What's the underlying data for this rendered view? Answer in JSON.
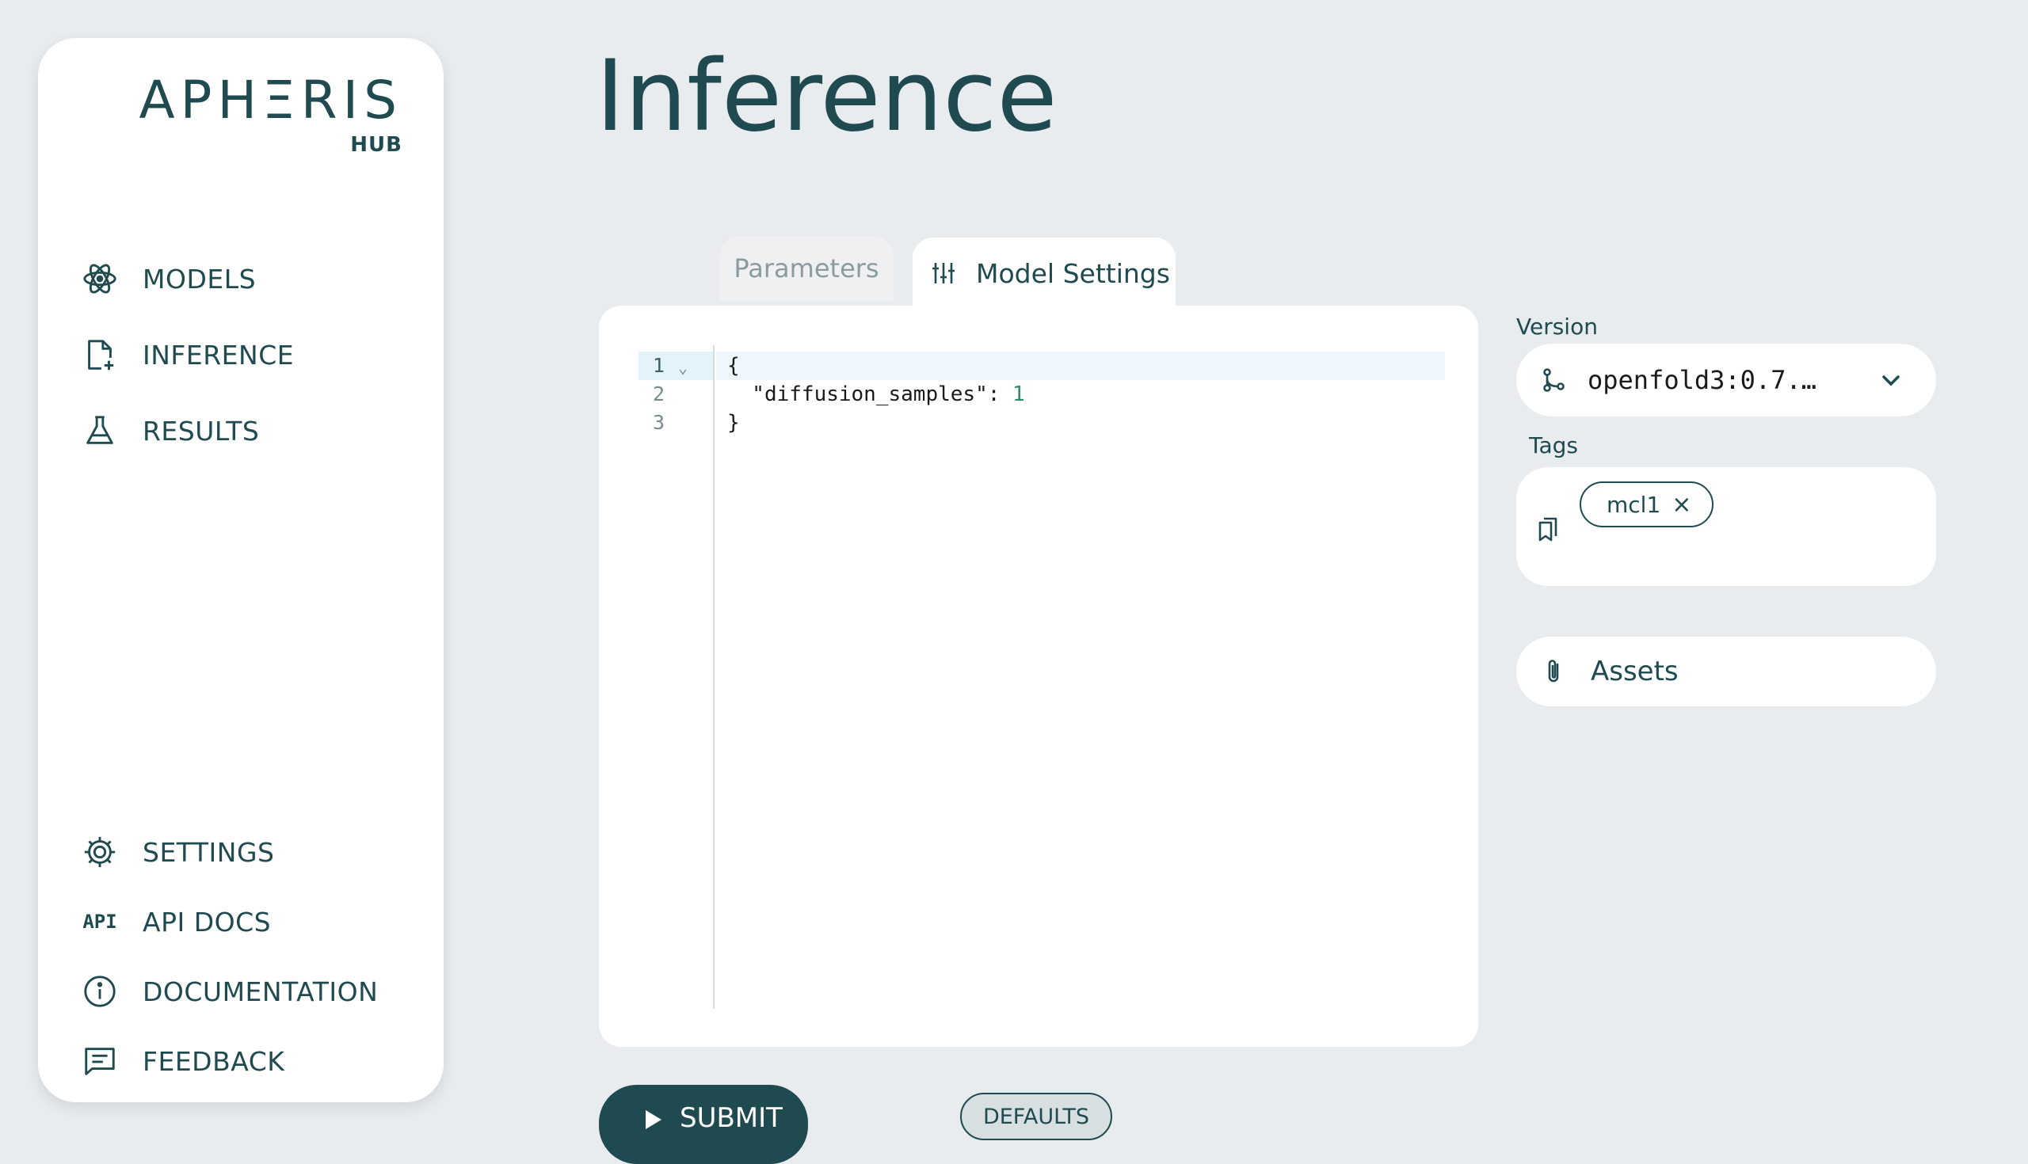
{
  "logo": {
    "word": "APHΞRIS",
    "sub": "HUB"
  },
  "sidebar": {
    "top_items": [
      {
        "label": "MODELS",
        "icon": "atom-icon"
      },
      {
        "label": "INFERENCE",
        "icon": "file-plus-icon"
      },
      {
        "label": "RESULTS",
        "icon": "flask-icon"
      }
    ],
    "bottom_items": [
      {
        "label": "SETTINGS",
        "icon": "gear-icon"
      },
      {
        "label": "API DOCS",
        "icon": "api-icon",
        "glyph": "API"
      },
      {
        "label": "DOCUMENTATION",
        "icon": "info-icon"
      },
      {
        "label": "FEEDBACK",
        "icon": "message-icon"
      }
    ]
  },
  "page": {
    "title": "Inference"
  },
  "tabs": [
    {
      "label": "Parameters",
      "active": false
    },
    {
      "label": "Model Settings",
      "active": true,
      "icon": "sliders-icon"
    }
  ],
  "editor": {
    "line_numbers": [
      "1",
      "2",
      "3"
    ],
    "fold_marker": "⌄",
    "lines": [
      "{",
      "  \"diffusion_samples\": ",
      "}"
    ],
    "value": "1"
  },
  "version": {
    "label": "Version",
    "value": "openfold3:0.7.…"
  },
  "tags": {
    "label": "Tags",
    "items": [
      "mcl1"
    ],
    "remove_glyph": "×"
  },
  "assets": {
    "label": "Assets"
  },
  "actions": {
    "submit_label": "SUBMIT",
    "defaults_label": "DEFAULTS"
  },
  "colors": {
    "brand": "#1f4a4f",
    "background": "#e8ecee",
    "active_line": "#e4f2f9"
  }
}
